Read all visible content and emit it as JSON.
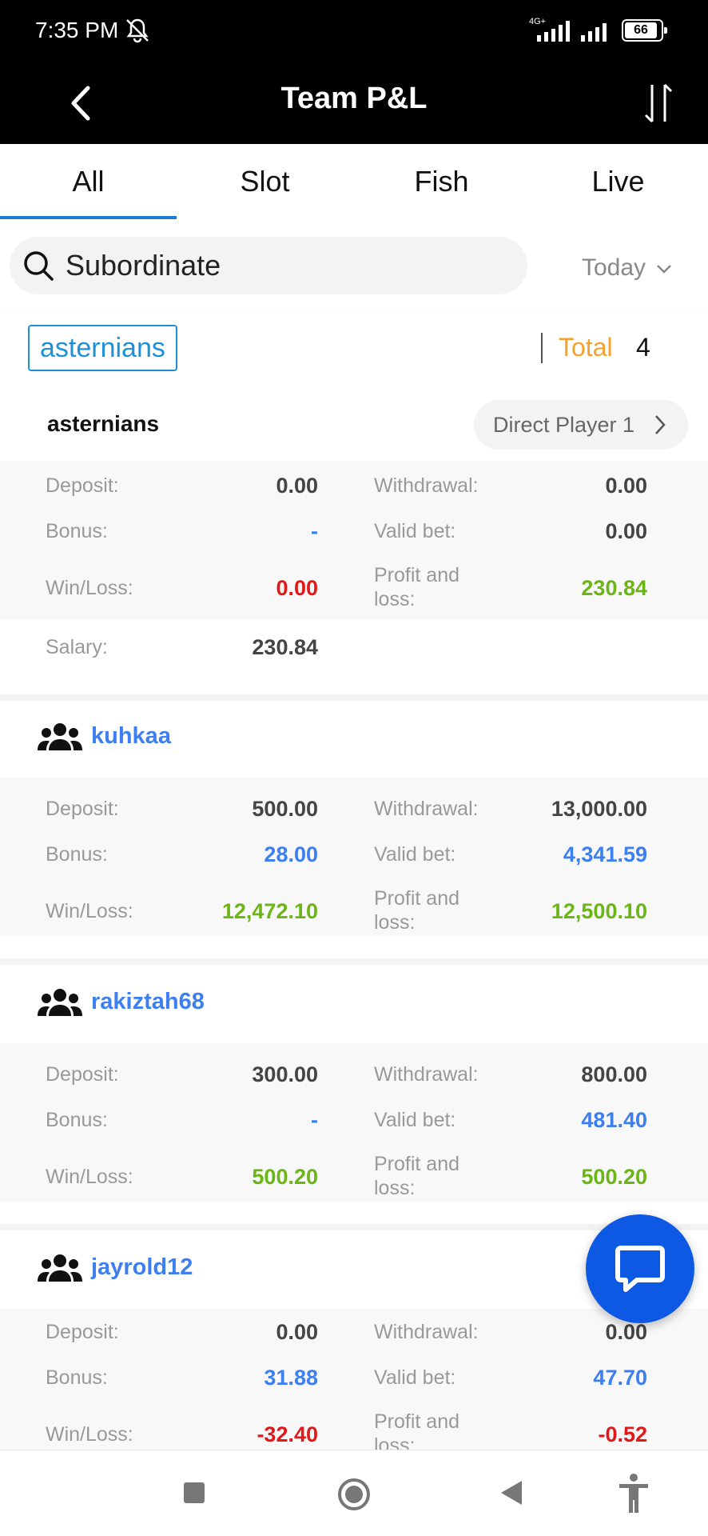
{
  "status_bar": {
    "time": "7:35 PM",
    "network": "4G+",
    "battery": "66"
  },
  "header": {
    "title": "Team P&L",
    "back_icon": "chevron-left-icon",
    "sort_icon": "sort-arrows-icon"
  },
  "tabs": [
    {
      "label": "All",
      "active": true
    },
    {
      "label": "Slot",
      "active": false
    },
    {
      "label": "Fish",
      "active": false
    },
    {
      "label": "Live",
      "active": false
    }
  ],
  "search": {
    "placeholder": "Subordinate",
    "date_filter": "Today"
  },
  "filter": {
    "chip": "asternians",
    "total_label": "Total",
    "total_value": "4"
  },
  "labels": {
    "deposit": "Deposit:",
    "withdrawal": "Withdrawal:",
    "bonus": "Bonus:",
    "valid_bet": "Valid bet:",
    "win_loss": "Win/Loss:",
    "profit_loss_1": "Profit and",
    "profit_loss_2": "loss:",
    "salary": "Salary:"
  },
  "owner": {
    "name": "asternians",
    "direct_player": "Direct Player 1",
    "deposit": "0.00",
    "withdrawal": "0.00",
    "bonus": "-",
    "valid_bet": "0.00",
    "win_loss": "0.00",
    "profit_loss": "230.84",
    "salary": "230.84"
  },
  "members": [
    {
      "name": "kuhkaa",
      "deposit": "500.00",
      "withdrawal": "13,000.00",
      "bonus": "28.00",
      "valid_bet": "4,341.59",
      "win_loss": "12,472.10",
      "profit_loss": "12,500.10"
    },
    {
      "name": "rakiztah68",
      "deposit": "300.00",
      "withdrawal": "800.00",
      "bonus": "-",
      "valid_bet": "481.40",
      "win_loss": "500.20",
      "profit_loss": "500.20"
    },
    {
      "name": "jayrold12",
      "deposit": "0.00",
      "withdrawal": "0.00",
      "bonus": "31.88",
      "valid_bet": "47.70",
      "win_loss": "-32.40",
      "profit_loss": "-0.52"
    }
  ],
  "colors": {
    "accent": "#1e7fd8",
    "positive": "#6cb516",
    "negative": "#e21818",
    "link": "#3d7ff0",
    "total": "#f5a12a",
    "chat": "#0e59e3"
  }
}
